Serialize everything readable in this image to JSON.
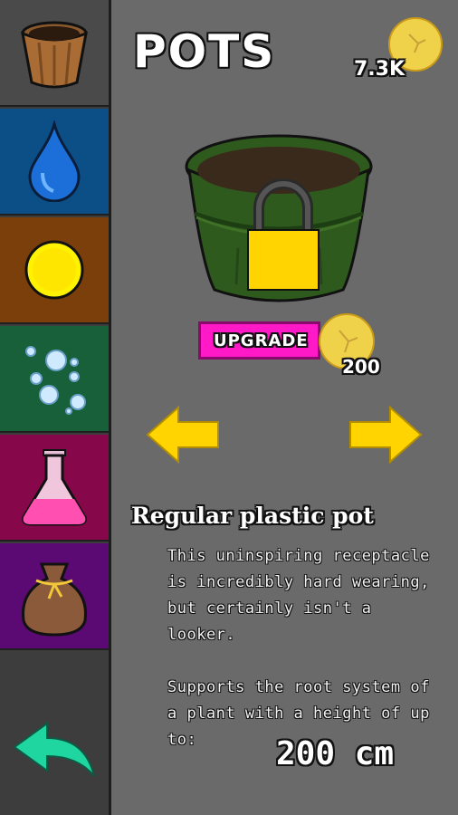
{
  "header": {
    "title": "POTS",
    "coins": "7.3K"
  },
  "sidebar": {
    "tabs": [
      {
        "name": "pots",
        "icon": "pot-icon",
        "color": "#4a4a4a"
      },
      {
        "name": "water",
        "icon": "water-drop-icon",
        "color": "#0b4f86"
      },
      {
        "name": "coins",
        "icon": "coin-icon",
        "color": "#7b3f0b"
      },
      {
        "name": "nutrients",
        "icon": "bubbles-icon",
        "color": "#17603a"
      },
      {
        "name": "potions",
        "icon": "flask-icon",
        "color": "#86084a"
      },
      {
        "name": "seeds",
        "icon": "seed-bag-icon",
        "color": "#5a0a72"
      }
    ],
    "back_icon": "back-arrow-icon"
  },
  "item": {
    "locked": true,
    "upgrade_label": "UPGRADE",
    "upgrade_cost": "200",
    "name": "Regular plastic pot",
    "description_1": "This uninspiring receptacle is incredibly hard wearing, but certainly isn't a looker.",
    "description_2": "Supports the root system of a plant with a height of up to:",
    "max_height": "200 cm"
  },
  "colors": {
    "upgrade_button": "#ff19c7",
    "arrow": "#ffd400",
    "coin": "#f0d24a",
    "pot_green": "#2f5a1d",
    "back_arrow": "#1fd6a0"
  }
}
